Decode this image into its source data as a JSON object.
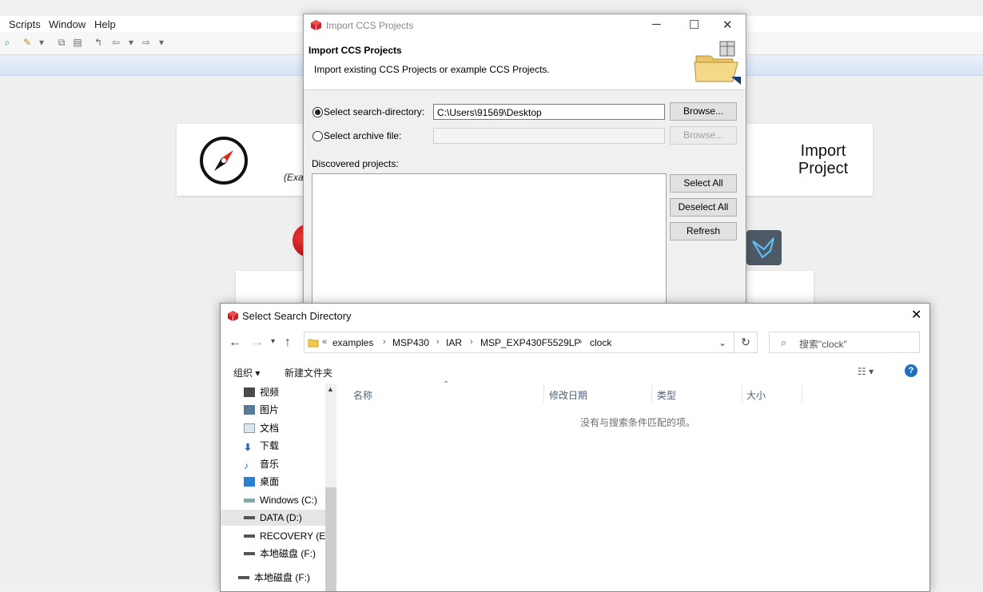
{
  "menubar": {
    "items": [
      "Scripts",
      "Window",
      "Help"
    ]
  },
  "welcome": {
    "import_project": "Import Project",
    "exa_fragment": "(Exa"
  },
  "import_dialog": {
    "title": "Import CCS Projects",
    "heading": "Import CCS Projects",
    "subheading": "Import existing CCS Projects or example CCS Projects.",
    "search_dir_label": "Select search-directory:",
    "search_dir_value": "C:\\Users\\91569\\Desktop",
    "archive_label": "Select archive file:",
    "browse_label": "Browse...",
    "discovered_label": "Discovered projects:",
    "select_all": "Select All",
    "deselect_all": "Deselect All",
    "refresh": "Refresh"
  },
  "dir_dialog": {
    "title": "Select Search Directory",
    "breadcrumb_prefix": "«",
    "breadcrumb": [
      "examples",
      "MSP430",
      "IAR",
      "MSP_EXP430F5529LP",
      "clock"
    ],
    "search_placeholder": "搜索\"clock\"",
    "organize": "组织 ▾",
    "new_folder": "新建文件夹",
    "nav_items": [
      {
        "label": "视频",
        "icon": "video-icon"
      },
      {
        "label": "图片",
        "icon": "pictures-icon"
      },
      {
        "label": "文档",
        "icon": "documents-icon"
      },
      {
        "label": "下载",
        "icon": "download-icon"
      },
      {
        "label": "音乐",
        "icon": "music-icon"
      },
      {
        "label": "桌面",
        "icon": "desktop-icon"
      },
      {
        "label": "Windows (C:)",
        "icon": "drive-icon"
      },
      {
        "label": "DATA (D:)",
        "icon": "drive-icon",
        "selected": true
      },
      {
        "label": "RECOVERY (E:)",
        "icon": "drive-icon"
      },
      {
        "label": "本地磁盘 (F:)",
        "icon": "drive-icon"
      },
      {
        "label": "本地磁盘 (F:)",
        "icon": "drive-icon"
      }
    ],
    "columns": [
      "名称",
      "修改日期",
      "类型",
      "大小"
    ],
    "empty_message": "没有与搜索条件匹配的项。"
  },
  "colors": {
    "accent_blue": "#1f6fbf",
    "ccs_red": "#d0202a"
  }
}
